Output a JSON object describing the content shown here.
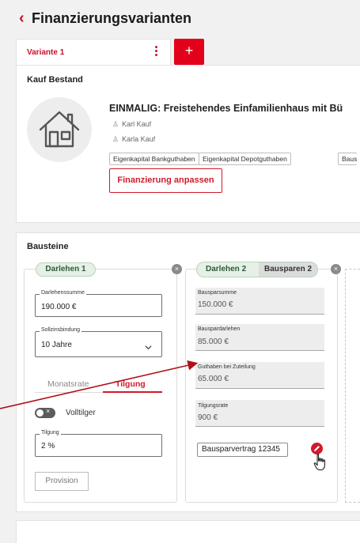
{
  "header": {
    "title": "Finanzierungsvarianten"
  },
  "variant_tabs": {
    "active_label": "Variante 1",
    "add_label": "+"
  },
  "property": {
    "section_title": "Kauf Bestand",
    "title": "EINMALIG: Freistehendes Einfamilienhaus mit Bü",
    "persons": [
      "Karl Kauf",
      "Karla Kauf"
    ],
    "chips": [
      "Eigenkapital Bankguthaben",
      "Eigenkapital Depotguthaben",
      "Baus"
    ],
    "adjust_button": "Finanzierung anpassen"
  },
  "bausteine": {
    "title": "Bausteine",
    "block1": {
      "pill": "Darlehen 1",
      "darlehenssumme_label": "Darlehenssumme",
      "darlehenssumme_value": "190.000 €",
      "sollzins_label": "Sollzinsbindung",
      "sollzins_value": "10 Jahre",
      "tab_monatsrate": "Monatsrate",
      "tab_tilgung": "Tilgung",
      "volltilger_label": "Volltilger",
      "tilgung_label": "Tilgung",
      "tilgung_value": "2 %",
      "provision_button": "Provision"
    },
    "block2": {
      "pill_darlehen": "Darlehen 2",
      "pill_bausparen": "Bausparen 2",
      "fields": [
        {
          "label": "Bausparsumme",
          "value": "150.000 €"
        },
        {
          "label": "Bauspardarlehen",
          "value": "85.000 €"
        },
        {
          "label": "Guthaben bei Zuteilung",
          "value": "65.000 €"
        },
        {
          "label": "Tilgungsrate",
          "value": "900 €"
        }
      ],
      "contract_button": "Bausparvertrag 12345"
    }
  },
  "colors": {
    "accent": "#c8102e",
    "pill_bg": "#e6f0e6",
    "annotation_arrow": "#b00f1a"
  }
}
